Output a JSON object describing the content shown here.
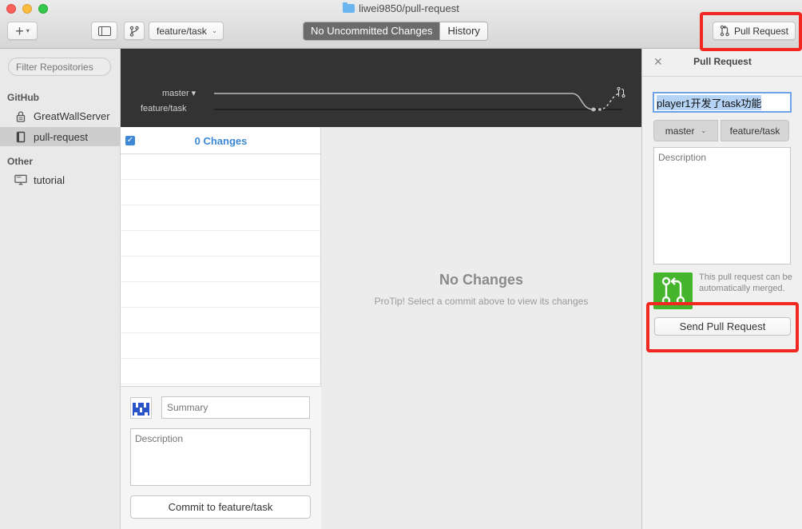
{
  "window": {
    "title": "liwei9850/pull-request"
  },
  "toolbar": {
    "add_symbol": "+",
    "current_branch": "feature/task",
    "tabs": [
      {
        "label": "No Uncommitted Changes",
        "active": true
      },
      {
        "label": "History",
        "active": false
      }
    ],
    "pull_request_label": "Pull Request"
  },
  "sidebar": {
    "filter_placeholder": "Filter Repositories",
    "sections": [
      {
        "title": "GitHub",
        "items": [
          {
            "label": "GreatWallServer",
            "icon": "lock-icon",
            "selected": false
          },
          {
            "label": "pull-request",
            "icon": "repo-book-icon",
            "selected": true
          }
        ]
      },
      {
        "title": "Other",
        "items": [
          {
            "label": "tutorial",
            "icon": "monitor-icon",
            "selected": false
          }
        ]
      }
    ]
  },
  "graph": {
    "branch_primary": "master",
    "branch_secondary": "feature/task"
  },
  "changes": {
    "count_label": "0 Changes",
    "all_checked": true,
    "summary_placeholder": "Summary",
    "description_placeholder": "Description",
    "commit_button": "Commit to feature/task"
  },
  "main": {
    "heading": "No Changes",
    "protip": "ProTip! Select a commit above to view its changes"
  },
  "pr_panel": {
    "title": "Pull Request",
    "close_symbol": "✕",
    "pr_title_value": "player1开发了task功能",
    "base_branch": "master",
    "head_branch": "feature/task",
    "description_placeholder": "Description",
    "merge_status": "This pull request can be automatically merged.",
    "send_button": "Send Pull Request"
  },
  "colors": {
    "accent_blue": "#3d88d6",
    "merge_green": "#44b52d",
    "highlight_red": "#f2271f",
    "graph_bg": "#333333"
  }
}
